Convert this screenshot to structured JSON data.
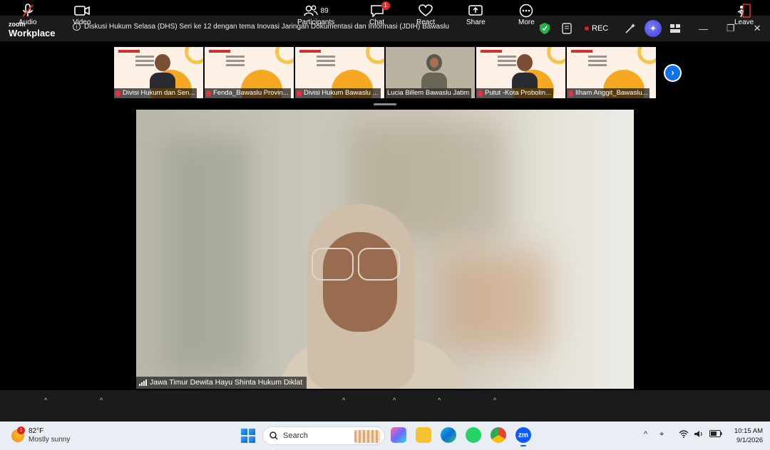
{
  "app": {
    "logo_top": "zoom",
    "logo_bottom": "Workplace"
  },
  "meeting": {
    "title": "Diskusi Hukum Selasa (DHS) Seri ke 12 dengan tema Inovasi Jaringan Dokumentasi dan Informasi (JDIH) Bawaslu",
    "rec_label": "REC"
  },
  "participants_strip": [
    {
      "name": "Divisi Hukum dan Sen..."
    },
    {
      "name": "Fenda_Bawaslu Provin..."
    },
    {
      "name": "Divisi Hukum Bawaslu ..."
    },
    {
      "name": "Lucia Billem Bawaslu Jatim"
    },
    {
      "name": "Putut -Kota Probolin..."
    },
    {
      "name": "Ilham Anggit_Bawaslu..."
    }
  ],
  "speaker": {
    "name": "Jawa Timur Dewita Hayu Shinta Hukum Diklat"
  },
  "toolbar": {
    "audio": "Audio",
    "video": "Video",
    "participants": "Participants",
    "participants_count": "89",
    "chat": "Chat",
    "chat_badge": "1",
    "react": "React",
    "share": "Share",
    "more": "More",
    "leave": "Leave"
  },
  "taskbar": {
    "weather_temp": "82°F",
    "weather_desc": "Mostly sunny",
    "weather_badge": "1",
    "search_placeholder": "Search",
    "time": "10:15 AM",
    "date": "9/1/2026",
    "zoom_app": "zm"
  }
}
